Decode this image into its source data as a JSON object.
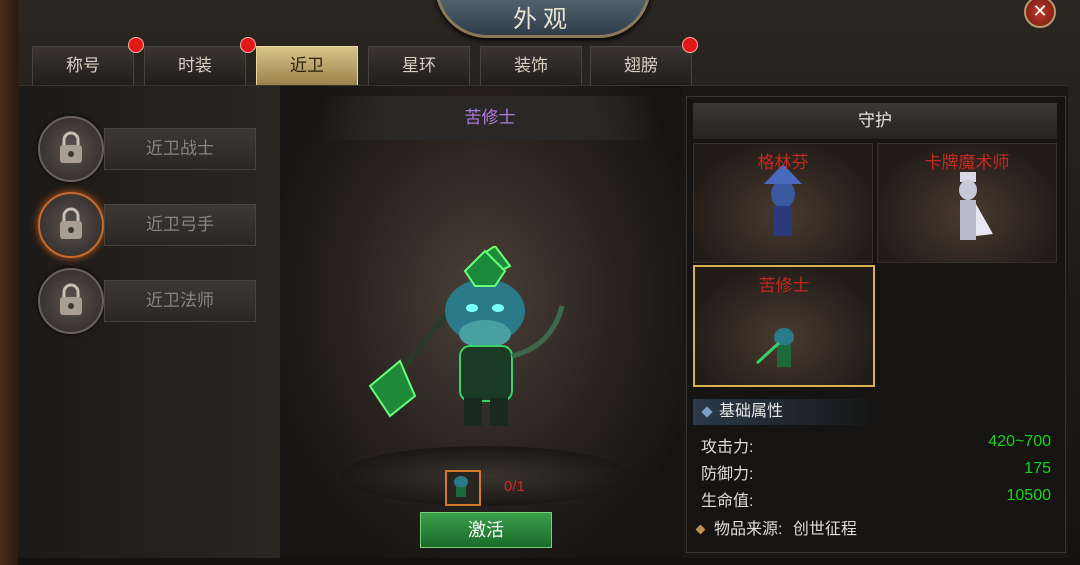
{
  "window": {
    "title": "外观",
    "close_icon": "close-icon"
  },
  "tabs": [
    {
      "label": "称号",
      "badge": true
    },
    {
      "label": "时装",
      "badge": true
    },
    {
      "label": "近卫",
      "badge": false,
      "active": true
    },
    {
      "label": "星环",
      "badge": false
    },
    {
      "label": "装饰",
      "badge": false
    },
    {
      "label": "翅膀",
      "badge": true
    }
  ],
  "roles": [
    {
      "label": "近卫战士",
      "icon": "lock-icon"
    },
    {
      "label": "近卫弓手",
      "icon": "lock-icon",
      "selected": true
    },
    {
      "label": "近卫法师",
      "icon": "lock-icon"
    }
  ],
  "preview": {
    "name": "苦修士",
    "count": "0/1",
    "activate_label": "激活"
  },
  "right": {
    "header": "守护",
    "skins": [
      {
        "name": "格林芬"
      },
      {
        "name": "卡牌魔术师"
      },
      {
        "name": "苦修士",
        "selected": true
      }
    ],
    "stats_title": "基础属性",
    "stats": [
      {
        "label": "攻击力:",
        "value": "420~700"
      },
      {
        "label": "防御力:",
        "value": "175"
      },
      {
        "label": "生命值:",
        "value": "10500"
      }
    ],
    "source_label": "物品来源:",
    "source_value": "创世征程"
  },
  "colors": {
    "badge": "#e01818",
    "stat_value": "#1ad41a",
    "preview_name": "#b07ae0",
    "skin_name": "#c42a20"
  }
}
